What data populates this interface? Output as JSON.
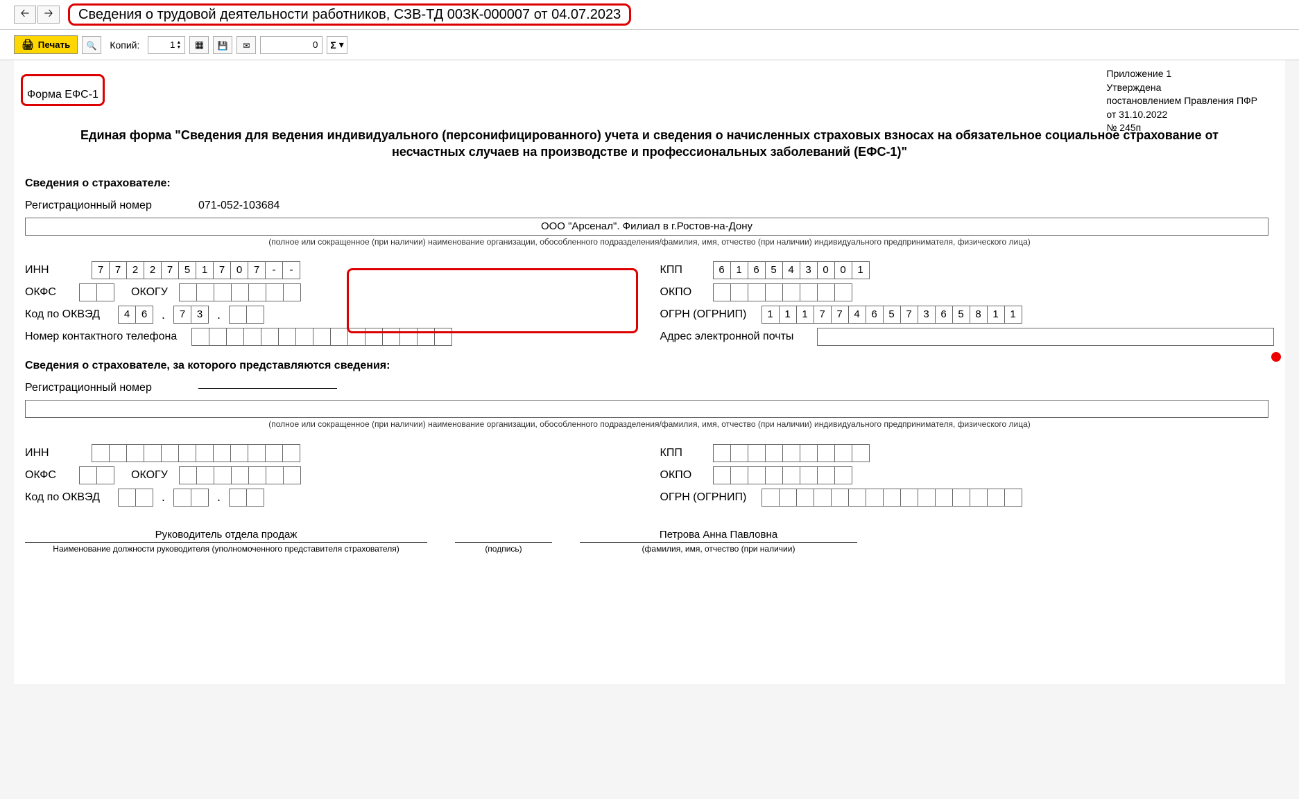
{
  "header": {
    "title": "Сведения о трудовой деятельности работников, СЗВ-ТД 00ЗК-000007 от 04.07.2023"
  },
  "toolbar": {
    "back_arrow": "🡠",
    "forward_arrow": "🡢",
    "print_label": "Печать",
    "copies_label": "Копий:",
    "copies_value": "1",
    "number_value": "0",
    "sigma_dropdown": "▾"
  },
  "approval": {
    "line1": "Приложение 1",
    "line2": "Утверждена",
    "line3": "постановлением Правления ПФР",
    "line4": "от 31.10.2022",
    "line5": "№ 245п"
  },
  "form": {
    "form_name": "Форма ЕФС-1",
    "main_title": "Единая форма \"Сведения для ведения индивидуального (персонифицированного) учета и сведения о начисленных страховых взносах на обязательное социальное страхование от несчастных случаев на производстве и профессиональных заболеваний (ЕФС-1)\"",
    "section_insurer": "Сведения о страхователе:",
    "reg_number_label": "Регистрационный номер",
    "reg_number_value": "071-052-103684",
    "org_name": "ООО \"Арсенал\". Филиал в г.Ростов-на-Дону",
    "org_caption": "(полное или сокращенное (при наличии) наименование организации, обособленного подразделения/фамилия, имя, отчество (при наличии) индивидуального предпринимателя, физического лица)",
    "inn_label": "ИНН",
    "inn_digits": [
      "7",
      "7",
      "2",
      "2",
      "7",
      "5",
      "1",
      "7",
      "0",
      "7",
      "-",
      "-"
    ],
    "kpp_label": "КПП",
    "kpp_digits": [
      "6",
      "1",
      "6",
      "5",
      "4",
      "3",
      "0",
      "0",
      "1"
    ],
    "okfs_label": "ОКФС",
    "okogu_label": "ОКОГУ",
    "okpo_label": "ОКПО",
    "okved_label": "Код по ОКВЭД",
    "okved_part1": [
      "4",
      "6"
    ],
    "okved_part2": [
      "7",
      "3"
    ],
    "okved_part3": [
      "",
      ""
    ],
    "ogrn_label": "ОГРН (ОГРНИП)",
    "ogrn_digits": [
      "1",
      "1",
      "1",
      "7",
      "7",
      "4",
      "6",
      "5",
      "7",
      "3",
      "6",
      "5",
      "8",
      "1",
      "1"
    ],
    "phone_label": "Номер контактного телефона",
    "email_label": "Адрес электронной почты",
    "section_insurer2": "Сведения о страхователе, за которого представляются сведения:",
    "sig_position": "Руководитель отдела продаж",
    "sig_position_caption": "Наименование должности руководителя (уполномоченного представителя страхователя)",
    "sig_sign_caption": "(подпись)",
    "sig_name": "Петрова Анна Павловна",
    "sig_name_caption": "(фамилия, имя, отчество (при наличии)"
  }
}
